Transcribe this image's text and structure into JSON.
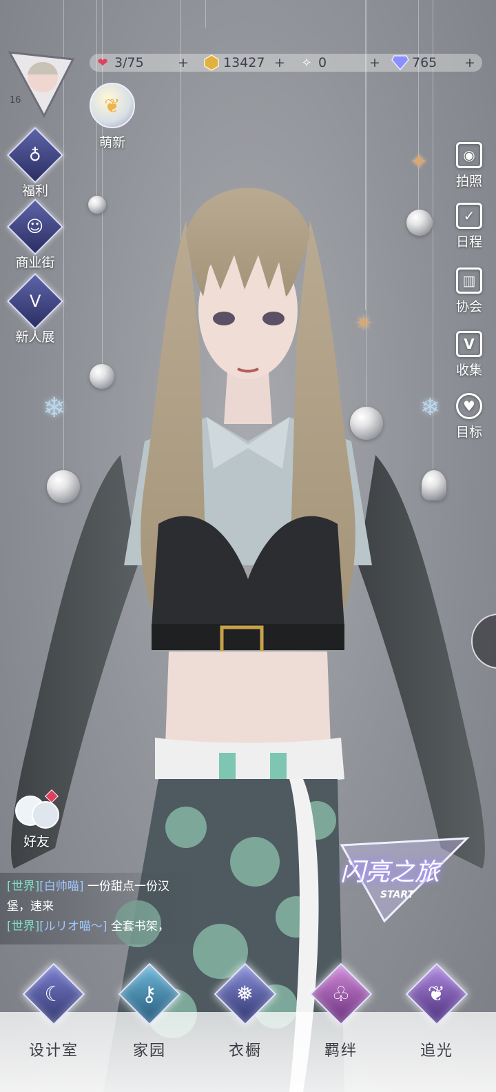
{
  "player": {
    "level": "16"
  },
  "resources": [
    {
      "icon": "heart-gem-icon",
      "value": "3/75",
      "color": "#e0405a"
    },
    {
      "icon": "gold-coin-icon",
      "value": "13427",
      "color": "#e0b040"
    },
    {
      "icon": "star-crystal-icon",
      "value": "0",
      "color": "#c8ccff"
    },
    {
      "icon": "diamond-icon",
      "value": "765",
      "color": "#7d82ff"
    }
  ],
  "event": {
    "label": "萌新"
  },
  "left_menu": [
    {
      "id": "welfare",
      "label": "福利",
      "icon": "hot-air-balloon-icon"
    },
    {
      "id": "commerce",
      "label": "商业街",
      "icon": "shopping-bag-icon"
    },
    {
      "id": "newcomer",
      "label": "新人展",
      "icon": "v-crown-icon"
    }
  ],
  "right_menu": [
    {
      "id": "photo",
      "label": "拍照",
      "icon": "camera-icon"
    },
    {
      "id": "schedule",
      "label": "日程",
      "icon": "calendar-check-icon"
    },
    {
      "id": "guild",
      "label": "协会",
      "icon": "building-icon"
    },
    {
      "id": "collection",
      "label": "收集",
      "icon": "v-badge-icon"
    },
    {
      "id": "goal",
      "label": "目标",
      "icon": "heart-medal-icon"
    }
  ],
  "friends": {
    "label": "好友"
  },
  "chat": [
    {
      "channel": "[世界]",
      "name": "[白帅喵]",
      "text": "一份甜点一份汉",
      "cont": "堡，速来"
    },
    {
      "channel": "[世界]",
      "name": "[ルリオ喵～]",
      "text": "全套书架，",
      "cont": ""
    }
  ],
  "promo": {
    "title": "闪亮之旅",
    "subtitle": "START"
  },
  "bottom_nav": [
    {
      "id": "design",
      "label": "设计室",
      "icon": "moon-star-icon",
      "color": "#4b4f9a"
    },
    {
      "id": "home",
      "label": "家园",
      "icon": "key-icon",
      "color": "#2c6d8f"
    },
    {
      "id": "wardrobe",
      "label": "衣橱",
      "icon": "snowflake-crystal-icon",
      "color": "#3a3f78"
    },
    {
      "id": "bond",
      "label": "羁绊",
      "icon": "clover-icon",
      "color": "#7a3f8a"
    },
    {
      "id": "chase",
      "label": "追光",
      "icon": "butterfly-icon",
      "color": "#5a3f8a"
    }
  ]
}
